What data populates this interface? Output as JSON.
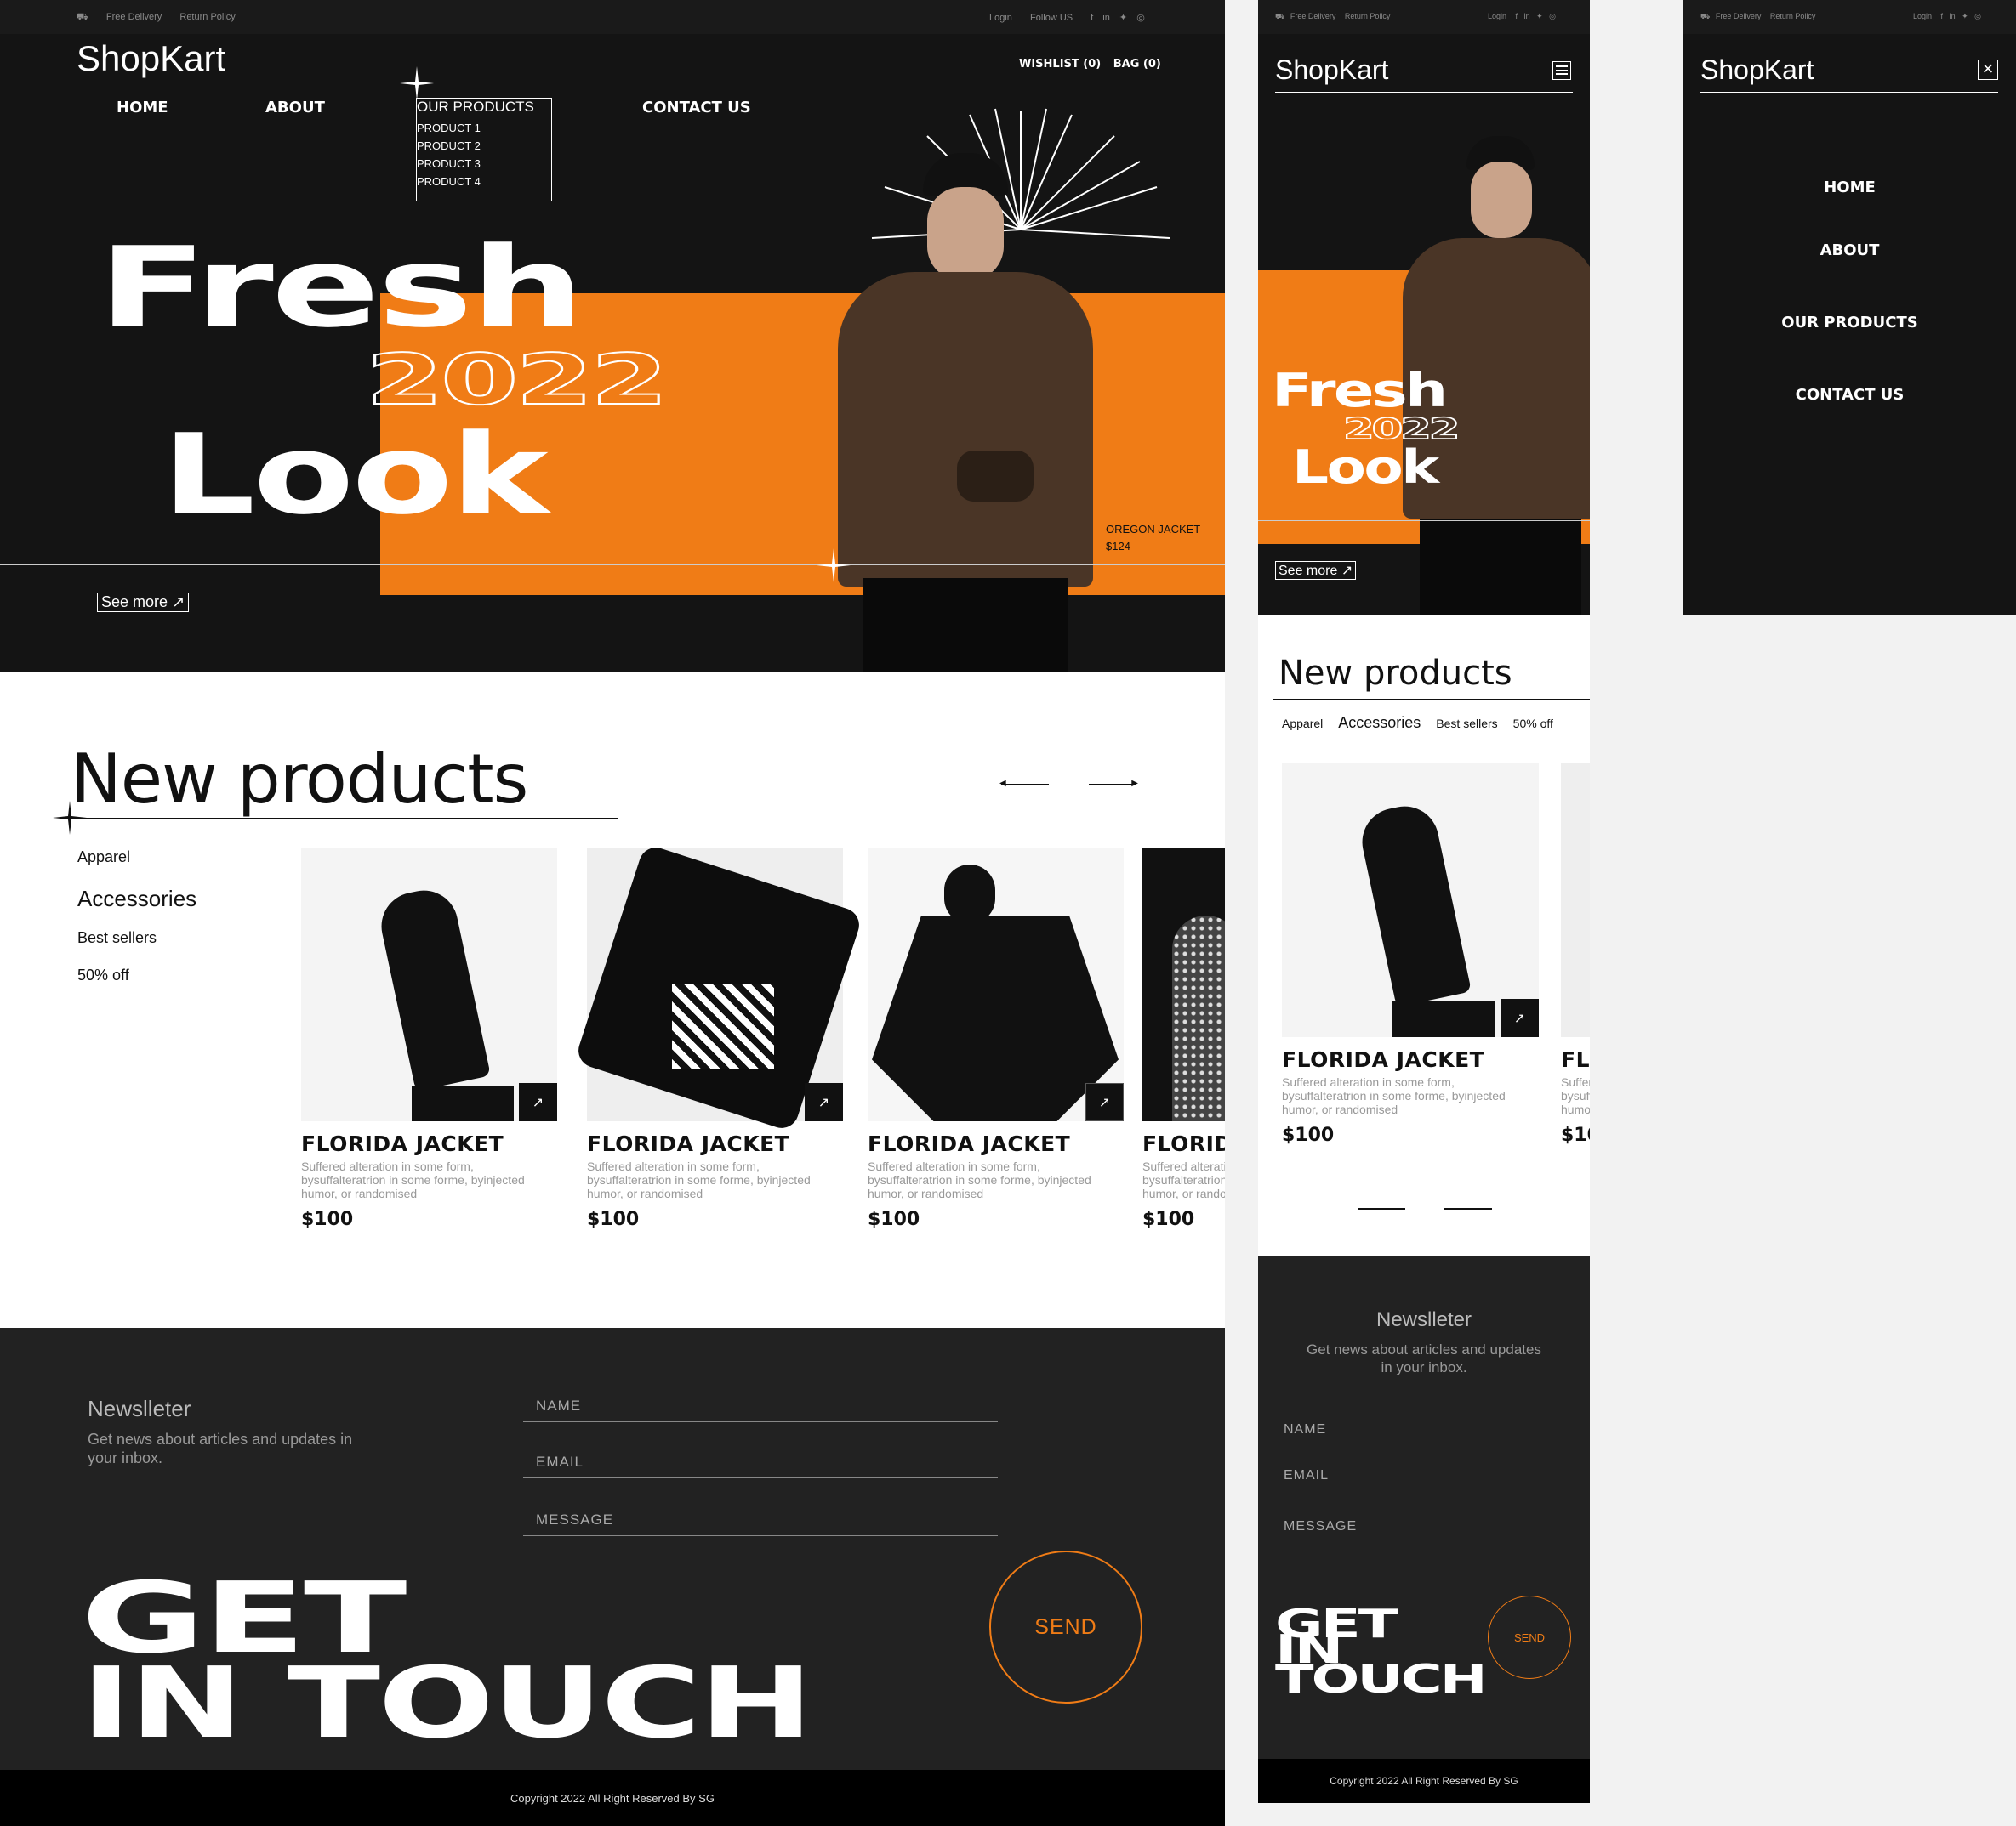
{
  "brand": "ShopKart",
  "topbar": {
    "free_delivery": "Free Delivery",
    "return_policy": "Return Policy",
    "login": "Login",
    "follow_us": "Follow US"
  },
  "header": {
    "wishlist": "WISHLIST (0)",
    "bag": "BAG (0)"
  },
  "nav": {
    "home": "HOME",
    "about": "ABOUT",
    "products": "OUR PRODUCTS",
    "contact": "CONTACT US",
    "dropdown": [
      "PRODUCT 1",
      "PRODUCT 2",
      "PRODUCT 3",
      "PRODUCT 4"
    ]
  },
  "hero": {
    "line1": "Fresh",
    "year": "2022",
    "line2": "Look",
    "product_name": "OREGON JACKET",
    "product_price": "$124",
    "see_more": "See more",
    "cta_arrow": "↗"
  },
  "products": {
    "title": "New products",
    "filters": [
      "Apparel",
      "Accessories",
      "Best sellers",
      "50% off"
    ],
    "cards": [
      {
        "name": "FLORIDA JACKET",
        "desc": "Suffered alteration in some form, bysuffalteratrion in some forme, byinjected humor, or randomised",
        "price": "$100"
      },
      {
        "name": "FLORIDA JACKET",
        "desc": "Suffered alteration in some form, bysuffalteratrion in some forme, byinjected humor, or randomised",
        "price": "$100"
      },
      {
        "name": "FLORIDA JACKET",
        "desc": "Suffered alteration in some form, bysuffalteratrion in some forme, byinjected humor, or randomised",
        "price": "$100"
      },
      {
        "name": "FLORIDA JACKET",
        "desc": "Suffered alteration in some form, bysuffalteratrion in some forme, byinjected humor, or randomised",
        "price": "$100"
      }
    ]
  },
  "newsletter": {
    "title": "Newslleter",
    "subtitle": "Get news about articles and updates in your inbox.",
    "name": "NAME",
    "email": "EMAIL",
    "message": "MESSAGE",
    "send": "SEND",
    "headline1": "GET",
    "headline2": "IN TOUCH",
    "headline_mobile": [
      "GET",
      "IN",
      "TOUCH"
    ]
  },
  "footer": {
    "copyright": "Copyright 2022 All Right Reserved By SG"
  },
  "colors": {
    "accent": "#f07c16",
    "dark": "#141414",
    "footer_bg": "#222222"
  }
}
